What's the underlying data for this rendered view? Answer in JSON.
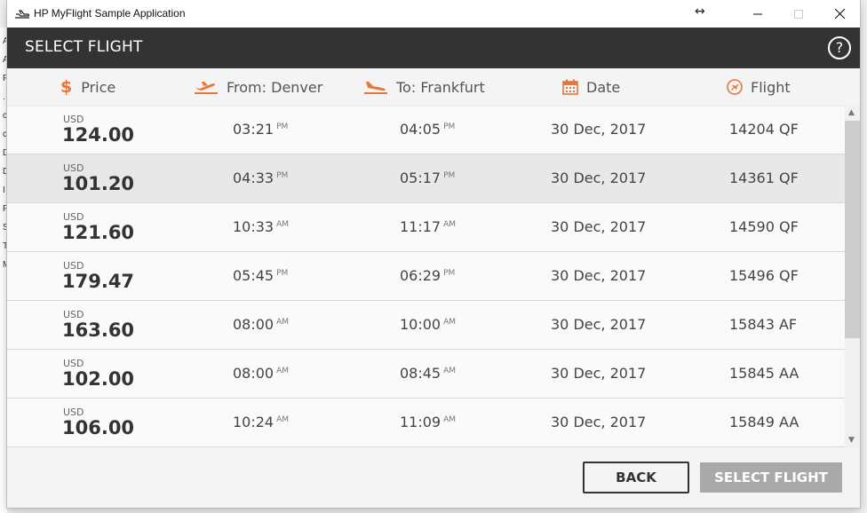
{
  "window": {
    "title": "HP MyFlight Sample Application"
  },
  "header": {
    "title": "SELECT FLIGHT",
    "help": "?"
  },
  "columns": {
    "price": "Price",
    "from": "From: Denver",
    "to": "To: Frankfurt",
    "date": "Date",
    "flight": "Flight"
  },
  "background_strip": [
    "m",
    "A",
    "A",
    "F",
    ".",
    "c",
    "c",
    "D",
    "D",
    "I",
    "F",
    "S",
    "T",
    "M"
  ],
  "flights": [
    {
      "currency": "USD",
      "price": "124.00",
      "depart": "03:21",
      "depart_ampm": "PM",
      "arrive": "04:05",
      "arrive_ampm": "PM",
      "date": "30 Dec, 2017",
      "flight": "14204 QF"
    },
    {
      "currency": "USD",
      "price": "101.20",
      "depart": "04:33",
      "depart_ampm": "PM",
      "arrive": "05:17",
      "arrive_ampm": "PM",
      "date": "30 Dec, 2017",
      "flight": "14361 QF"
    },
    {
      "currency": "USD",
      "price": "121.60",
      "depart": "10:33",
      "depart_ampm": "AM",
      "arrive": "11:17",
      "arrive_ampm": "AM",
      "date": "30 Dec, 2017",
      "flight": "14590 QF"
    },
    {
      "currency": "USD",
      "price": "179.47",
      "depart": "05:45",
      "depart_ampm": "PM",
      "arrive": "06:29",
      "arrive_ampm": "PM",
      "date": "30 Dec, 2017",
      "flight": "15496 QF"
    },
    {
      "currency": "USD",
      "price": "163.60",
      "depart": "08:00",
      "depart_ampm": "AM",
      "arrive": "10:00",
      "arrive_ampm": "AM",
      "date": "30 Dec, 2017",
      "flight": "15843 AF"
    },
    {
      "currency": "USD",
      "price": "102.00",
      "depart": "08:00",
      "depart_ampm": "AM",
      "arrive": "08:45",
      "arrive_ampm": "AM",
      "date": "30 Dec, 2017",
      "flight": "15845 AA"
    },
    {
      "currency": "USD",
      "price": "106.00",
      "depart": "10:24",
      "depart_ampm": "AM",
      "arrive": "11:09",
      "arrive_ampm": "AM",
      "date": "30 Dec, 2017",
      "flight": "15849 AA"
    }
  ],
  "footer": {
    "back": "BACK",
    "select": "SELECT FLIGHT"
  },
  "colors": {
    "accent": "#e8763a",
    "header_bg": "#333333",
    "disabled_button": "#a9a9a9"
  },
  "icons": {
    "app": "airplane-icon",
    "price": "dollar-icon",
    "from": "departure-icon",
    "to": "arrival-icon",
    "date": "calendar-icon",
    "flight": "flight-globe-icon"
  }
}
